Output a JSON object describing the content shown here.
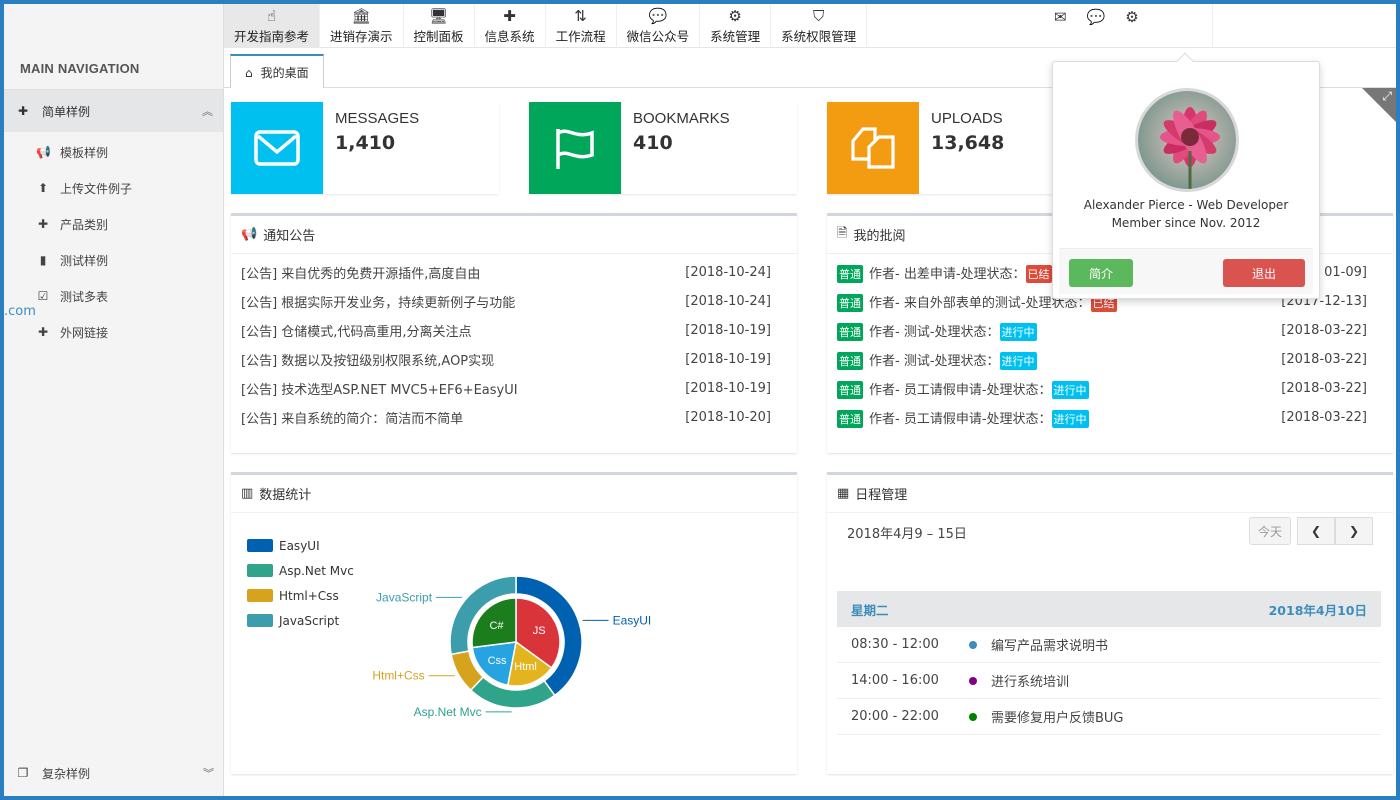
{
  "sidebar": {
    "header": "MAIN NAVIGATION",
    "active_group": {
      "label": "简单样例",
      "icon": "puzzle-icon"
    },
    "items": [
      {
        "label": "模板样例",
        "icon": "bullhorn-icon"
      },
      {
        "label": "上传文件例子",
        "icon": "upload-icon"
      },
      {
        "label": "产品类别",
        "icon": "puzzle-icon"
      },
      {
        "label": "测试样例",
        "icon": "book-icon"
      },
      {
        "label": "测试多表",
        "icon": "calendar-check-icon"
      },
      {
        "label": "外网链接",
        "icon": "puzzle-icon"
      }
    ],
    "bottom_group": {
      "label": "复杂样例",
      "icon": "copy-icon"
    },
    "side_text": ".com"
  },
  "topmenu": [
    {
      "label": "开发指南参考",
      "icon": "hand-pointer-icon"
    },
    {
      "label": "进销存演示",
      "icon": "bank-icon"
    },
    {
      "label": "控制面板",
      "icon": "monitor-icon"
    },
    {
      "label": "信息系统",
      "icon": "puzzle-icon"
    },
    {
      "label": "工作流程",
      "icon": "sort-icon"
    },
    {
      "label": "微信公众号",
      "icon": "wechat-icon"
    },
    {
      "label": "系统管理",
      "icon": "gears-icon"
    },
    {
      "label": "系统权限管理",
      "icon": "shield-icon"
    }
  ],
  "tab": {
    "label": "我的桌面",
    "icon": "home-icon"
  },
  "stats": [
    {
      "label": "MESSAGES",
      "value": "1,410",
      "color": "#00c0ef",
      "icon": "envelope-icon"
    },
    {
      "label": "BOOKMARKS",
      "value": "410",
      "color": "#00a65a",
      "icon": "flag-icon"
    },
    {
      "label": "UPLOADS",
      "value": "13,648",
      "color": "#f39c12",
      "icon": "files-icon"
    }
  ],
  "notices": {
    "title": "通知公告",
    "rows": [
      {
        "text": "[公告] 来自优秀的免费开源插件,高度自由",
        "date": "[2018-10-24]"
      },
      {
        "text": "[公告] 根据实际开发业务，持续更新例子与功能",
        "date": "[2018-10-24]"
      },
      {
        "text": "[公告] 仓储模式,代码高重用,分离关注点",
        "date": "[2018-10-19]"
      },
      {
        "text": "[公告] 数据以及按钮级别权限系统,AOP实现",
        "date": "[2018-10-19]"
      },
      {
        "text": "[公告] 技术选型ASP.NET MVC5+EF6+EasyUI",
        "date": "[2018-10-19]"
      },
      {
        "text": "[公告] 来自系统的简介：简洁而不简单",
        "date": "[2018-10-20]"
      }
    ]
  },
  "approvals": {
    "title": "我的批阅",
    "tag": "普通",
    "rows": [
      {
        "text": "作者- 出差申请-处理状态：",
        "status": "已结",
        "status_color": "red",
        "date": "01-09]"
      },
      {
        "text": "作者- 来自外部表单的测试-处理状态：",
        "status": "已结",
        "status_color": "red",
        "date": "[2017-12-13]"
      },
      {
        "text": "作者- 测试-处理状态：",
        "status": "进行中",
        "status_color": "blue",
        "date": "[2018-03-22]"
      },
      {
        "text": "作者- 测试-处理状态：",
        "status": "进行中",
        "status_color": "blue",
        "date": "[2018-03-22]"
      },
      {
        "text": "作者- 员工请假申请-处理状态：",
        "status": "进行中",
        "status_color": "blue",
        "date": "[2018-03-22]"
      },
      {
        "text": "作者- 员工请假申请-处理状态：",
        "status": "进行中",
        "status_color": "blue",
        "date": "[2018-03-22]"
      }
    ]
  },
  "stats_panel": {
    "title": "数据统计"
  },
  "chart_data": {
    "type": "pie",
    "legend": [
      "EasyUI",
      "Asp.Net Mvc",
      "Html+Css",
      "JavaScript"
    ],
    "outer": [
      {
        "name": "EasyUI",
        "value": 40,
        "color": "#0061b0"
      },
      {
        "name": "Asp.Net Mvc",
        "value": 22,
        "color": "#2fa48a"
      },
      {
        "name": "Html+Css",
        "value": 10,
        "color": "#d6a31c"
      },
      {
        "name": "JavaScript",
        "value": 28,
        "color": "#3c9eac"
      }
    ],
    "inner": [
      {
        "name": "JS",
        "value": 35,
        "color": "#d9343a"
      },
      {
        "name": "Html",
        "value": 18,
        "color": "#e3b41e"
      },
      {
        "name": "Css",
        "value": 20,
        "color": "#26a3e0"
      },
      {
        "name": "C#",
        "value": 27,
        "color": "#1b7d1b"
      }
    ]
  },
  "schedule": {
    "title": "日程管理",
    "range": "2018年4月9 – 15日",
    "today_btn": "今天",
    "day": "星期二",
    "date": "2018年4月10日",
    "events": [
      {
        "time": "08:30 - 12:00",
        "text": "编写产品需求说明书",
        "color": "#3c8dbc"
      },
      {
        "time": "14:00 - 16:00",
        "text": "进行系统培训",
        "color": "#800080"
      },
      {
        "time": "20:00 - 22:00",
        "text": "需要修复用户反馈BUG",
        "color": "#008000"
      }
    ]
  },
  "profile": {
    "name": "Alexander Pierce - Web Developer",
    "since": "Member since Nov. 2012",
    "btn_profile": "简介",
    "btn_logout": "退出"
  }
}
